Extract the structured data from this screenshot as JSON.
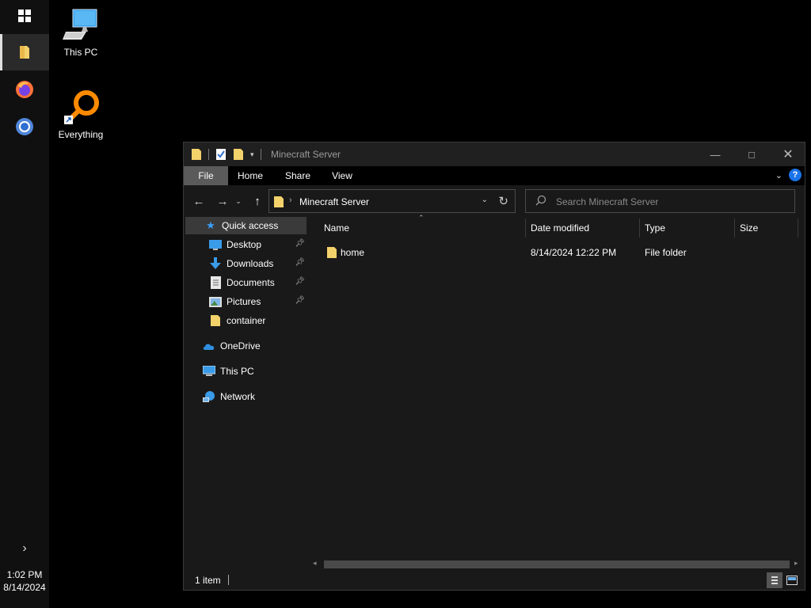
{
  "taskbar": {
    "clock_time": "1:02 PM",
    "clock_date": "8/14/2024",
    "items": [
      "start-icon",
      "file-explorer-icon",
      "firefox-icon",
      "chrome-icon"
    ]
  },
  "desktop": {
    "icons": [
      {
        "label": "This PC",
        "icon": "computer-icon"
      },
      {
        "label": "Everything",
        "icon": "everything-icon"
      }
    ]
  },
  "window": {
    "title": "Minecraft Server",
    "ribbon_tabs": [
      "File",
      "Home",
      "Share",
      "View"
    ],
    "address": {
      "crumb": "Minecraft Server"
    },
    "search": {
      "placeholder": "Search Minecraft Server"
    },
    "nav": {
      "quick_access": "Quick access",
      "items": [
        {
          "label": "Desktop",
          "icon": "desktop-icon",
          "pinned": true
        },
        {
          "label": "Downloads",
          "icon": "downloads-icon",
          "pinned": true
        },
        {
          "label": "Documents",
          "icon": "documents-icon",
          "pinned": true
        },
        {
          "label": "Pictures",
          "icon": "pictures-icon",
          "pinned": true
        },
        {
          "label": "container",
          "icon": "folder-icon",
          "pinned": false
        }
      ],
      "onedrive": "OneDrive",
      "this_pc": "This PC",
      "network": "Network"
    },
    "columns": {
      "name": "Name",
      "date": "Date modified",
      "type": "Type",
      "size": "Size"
    },
    "files": [
      {
        "name": "home",
        "date": "8/14/2024 12:22 PM",
        "type": "File folder",
        "size": ""
      }
    ],
    "status": {
      "count": "1 item"
    }
  },
  "colors": {
    "accent": "#1a73e8",
    "folder": "#f3d26b",
    "window_bg": "#191919"
  }
}
